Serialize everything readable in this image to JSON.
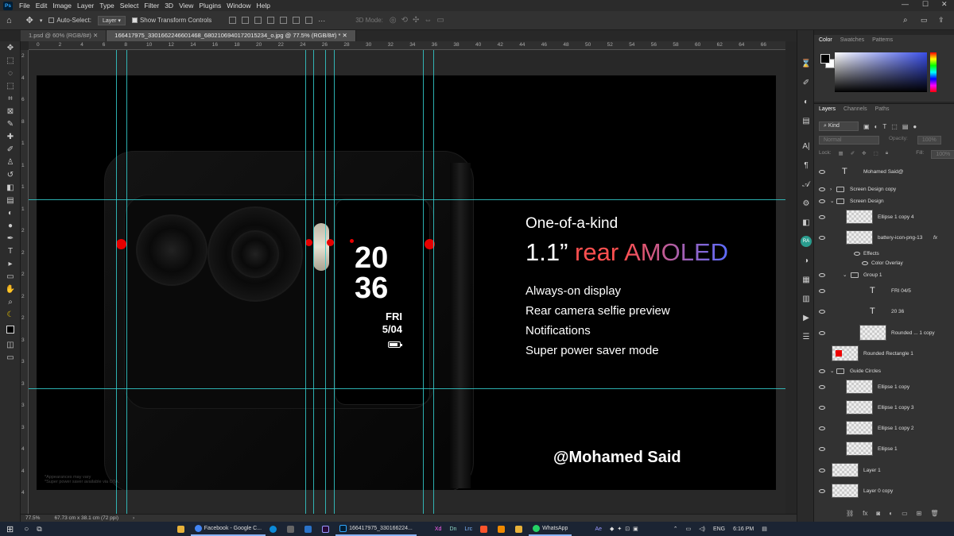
{
  "app": {
    "logo": "Ps"
  },
  "menu": [
    "File",
    "Edit",
    "Image",
    "Layer",
    "Type",
    "Select",
    "Filter",
    "3D",
    "View",
    "Plugins",
    "Window",
    "Help"
  ],
  "options": {
    "auto_select": "Auto-Select:",
    "auto_target": "Layer",
    "transform": "Show Transform Controls",
    "mode3d": "3D Mode:"
  },
  "tabs": [
    {
      "label": "1.psd @ 60% (RGB/8#)"
    },
    {
      "label": "166417975_3301662246601468_6802106940172015234_o.jpg @ 77.5% (RGB/8#) *"
    }
  ],
  "ruler_top": [
    "0",
    "2",
    "4",
    "6",
    "8",
    "10",
    "12",
    "14",
    "16",
    "18",
    "20",
    "22",
    "24",
    "26",
    "28",
    "30",
    "32",
    "34",
    "36",
    "38",
    "40",
    "42",
    "44",
    "46",
    "48",
    "50",
    "52",
    "54",
    "56",
    "58",
    "60",
    "62",
    "64",
    "66"
  ],
  "ruler_left": [
    "2",
    "4",
    "6",
    "8",
    "1",
    "1",
    "1",
    "1",
    "2",
    "2",
    "2",
    "2",
    "2",
    "3",
    "3",
    "3",
    "3",
    "3",
    "4",
    "4",
    "4"
  ],
  "artwork": {
    "time_hours": "20",
    "time_minutes": "36",
    "day": "FRI",
    "date": "5/04",
    "battery_level": 0.85,
    "tagline": "One-of-a-kind",
    "headline_size": "1.1”",
    "headline_rear": "rear",
    "headline_amoled": "AMOLED",
    "features": [
      "Always-on display",
      "Rear camera selfie preview",
      "Notifications",
      "Super power saver mode"
    ],
    "handle": "@Mohamed Said",
    "fineprint_1": "*Appearances may vary",
    "fineprint_2": "*Super power saver available via OTA.",
    "colors": {
      "rear": "#ff5050",
      "amoled_start": "#ff5050",
      "amoled_end": "#5b6cff",
      "guide": "#33cccc",
      "marker": "#e60000"
    }
  },
  "status": {
    "zoom": "77.5%",
    "doc_size": "67.73 cm x 38.1 cm (72 ppi)"
  },
  "color_panel": {
    "tabs": [
      "Color",
      "Swatches",
      "Patterns"
    ]
  },
  "layers_panel": {
    "tabs": [
      "Layers",
      "Channels",
      "Paths"
    ],
    "filter": "Kind",
    "blend": "Normal",
    "opacity_label": "Opacity:",
    "opacity": "100%",
    "lock_label": "Lock:",
    "fill_label": "Fill:",
    "fill": "100%",
    "layers": [
      {
        "name": "Mohamed Said@"
      },
      {
        "name": "Screen Design copy"
      },
      {
        "name": "Screen Design"
      },
      {
        "name": "Ellipse 1 copy 4"
      },
      {
        "name": "battery-icon-png-13"
      },
      {
        "name": "Effects"
      },
      {
        "name": "Color Overlay"
      },
      {
        "name": "Group 1"
      },
      {
        "name": "FRI 04/5"
      },
      {
        "name": "20 36"
      },
      {
        "name": "Rounded ... 1 copy"
      },
      {
        "name": "Rounded Rectangle 1"
      },
      {
        "name": "Guide Circles"
      },
      {
        "name": "Ellipse 1 copy"
      },
      {
        "name": "Ellipse 1 copy 3"
      },
      {
        "name": "Ellipse 1 copy 2"
      },
      {
        "name": "Ellipse 1"
      },
      {
        "name": "Layer 1"
      },
      {
        "name": "Layer 0 copy"
      }
    ]
  },
  "taskbar": {
    "apps": [
      {
        "label": "Facebook - Google C..."
      },
      {
        "label": "166417975_330166224..."
      },
      {
        "label": "WhatsApp"
      }
    ],
    "icons": [
      "Xd",
      "Dn",
      "Lrc",
      "Ae"
    ],
    "lang": "ENG",
    "time": "6:16 PM"
  }
}
